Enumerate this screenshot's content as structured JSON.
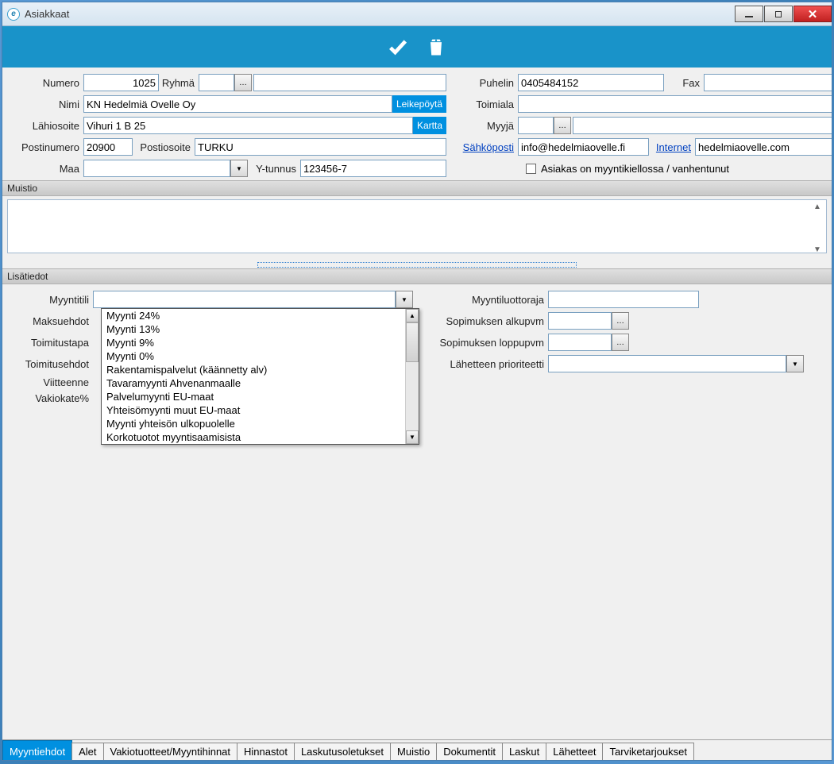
{
  "window": {
    "title": "Asiakkaat"
  },
  "toolbar": {
    "ok_icon": "checkmark",
    "delete_icon": "trash"
  },
  "form": {
    "numero_label": "Numero",
    "numero": "1025",
    "ryhma_label": "Ryhmä",
    "ryhma": "",
    "nimi_label": "Nimi",
    "nimi": "KN Hedelmiä Ovelle Oy",
    "leikepoyta_btn": "Leikepöytä",
    "lahiosoite_label": "Lähiosoite",
    "lahiosoite": "Vihuri 1 B 25",
    "kartta_btn": "Kartta",
    "postinumero_label": "Postinumero",
    "postinumero": "20900",
    "postiosoite_label": "Postiosoite",
    "postiosoite": "TURKU",
    "maa_label": "Maa",
    "maa": "",
    "ytunnus_label": "Y-tunnus",
    "ytunnus": "123456-7",
    "puhelin_label": "Puhelin",
    "puhelin": "0405484152",
    "fax_label": "Fax",
    "fax": "",
    "toimiala_label": "Toimiala",
    "toimiala": "",
    "myyja_label": "Myyjä",
    "myyja": "",
    "sahkoposti_label": "Sähköposti",
    "sahkoposti": "info@hedelmiaovelle.fi",
    "internet_label": "Internet",
    "internet": "hedelmiaovelle.com",
    "myyntikielto_label": "Asiakas on myyntikiellossa / vanhentunut",
    "myyntikielto_checked": false
  },
  "muistio_header": "Muistio",
  "muistio": "",
  "lisatiedot_header": "Lisätiedot",
  "lisatiedot": {
    "myyntitili_label": "Myyntitili",
    "myyntitili": "",
    "maksuehdot_label": "Maksuehdot",
    "toimitustapa_label": "Toimitustapa",
    "toimitusehdot_label": "Toimitusehdot",
    "viitteenne_label": "Viitteenne",
    "vakiokate_label": "Vakiokate%",
    "myyntiluottoraja_label": "Myyntiluottoraja",
    "myyntiluottoraja": "",
    "sopimus_alku_label": "Sopimuksen alkupvm",
    "sopimus_alku": "",
    "sopimus_loppu_label": "Sopimuksen loppupvm",
    "sopimus_loppu": "",
    "lahete_prio_label": "Lähetteen prioriteetti",
    "lahete_prio": "",
    "dropdown_options": [
      "Myynti 24%",
      "Myynti 13%",
      "Myynti 9%",
      "Myynti 0%",
      "Rakentamispalvelut (käännetty alv)",
      "Tavaramyynti Ahvenanmaalle",
      "Palvelumyynti EU-maat",
      "Yhteisömyynti muut EU-maat",
      "Myynti yhteisön ulkopuolelle",
      "Korkotuotot myyntisaamisista"
    ]
  },
  "tabs": [
    "Myyntiehdot",
    "Alet",
    "Vakiotuotteet/Myyntihinnat",
    "Hinnastot",
    "Laskutusoletukset",
    "Muistio",
    "Dokumentit",
    "Laskut",
    "Lähetteet",
    "Tarviketarjoukset"
  ],
  "active_tab_index": 0
}
